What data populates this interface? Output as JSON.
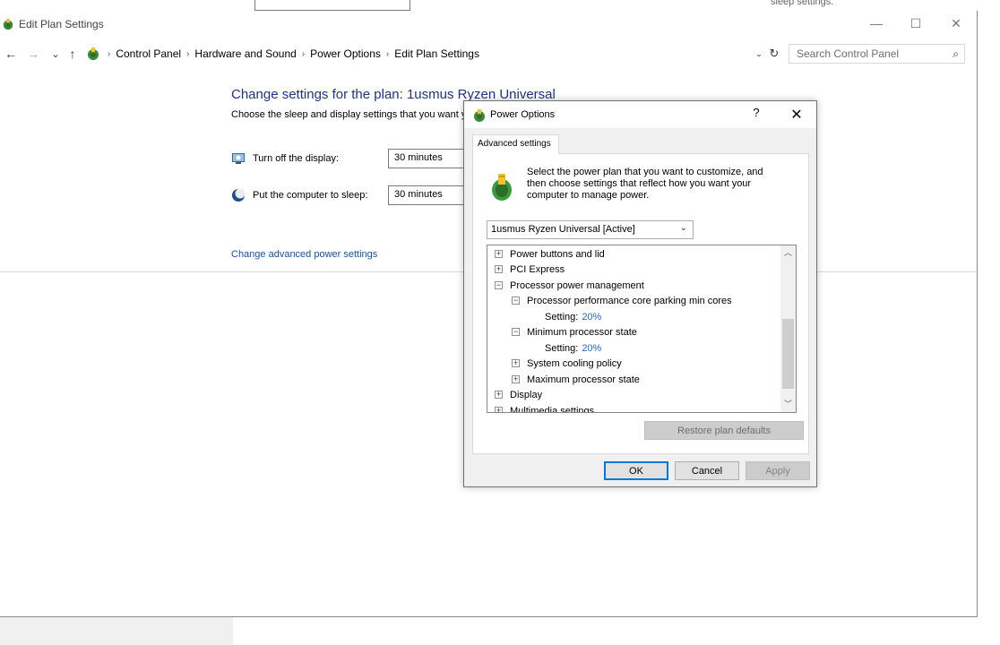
{
  "background": {
    "partial_text": "sleep settings."
  },
  "window": {
    "title": "Edit Plan Settings",
    "controls": {
      "minimize": "—",
      "maximize": "☐",
      "close": "✕"
    }
  },
  "nav": {
    "back": "←",
    "forward": "→",
    "recent": "⌄",
    "up": "↑"
  },
  "address": {
    "breadcrumbs": [
      "Control Panel",
      "Hardware and Sound",
      "Power Options",
      "Edit Plan Settings"
    ],
    "separator": "›",
    "dropdown": "⌄",
    "refresh": "↻"
  },
  "search": {
    "placeholder": "Search Control Panel",
    "icon": "⌕"
  },
  "plan": {
    "heading": "Change settings for the plan: 1usmus Ryzen Universal",
    "subtitle": "Choose the sleep and display settings that you want your computer to use.",
    "display_label": "Turn off the display:",
    "display_value": "30 minutes",
    "sleep_label": "Put the computer to sleep:",
    "sleep_value": "30 minutes",
    "advanced_link": "Change advanced power settings"
  },
  "dialog": {
    "title": "Power Options",
    "help": "?",
    "close": "✕",
    "tab": "Advanced settings",
    "intro": [
      "Select the power plan that you want to customize, and",
      "then choose settings that reflect how you want your",
      "computer to manage power."
    ],
    "plan_select": "1usmus Ryzen Universal [Active]",
    "tree": [
      {
        "expander": "+",
        "label": "Power buttons and lid"
      },
      {
        "expander": "+",
        "label": "PCI Express"
      },
      {
        "expander": "−",
        "label": "Processor power management"
      },
      {
        "expander": "−",
        "label": "Processor performance core parking min cores"
      },
      {
        "label": "Setting:",
        "value": "20%"
      },
      {
        "expander": "−",
        "label": "Minimum processor state"
      },
      {
        "label": "Setting:",
        "value": "20%"
      },
      {
        "expander": "+",
        "label": "System cooling policy"
      },
      {
        "expander": "+",
        "label": "Maximum processor state"
      },
      {
        "expander": "+",
        "label": "Display"
      },
      {
        "expander": "+",
        "label": "Multimedia settings"
      }
    ],
    "restore_button": "Restore plan defaults",
    "ok_button": "OK",
    "cancel_button": "Cancel",
    "apply_button": "Apply"
  }
}
